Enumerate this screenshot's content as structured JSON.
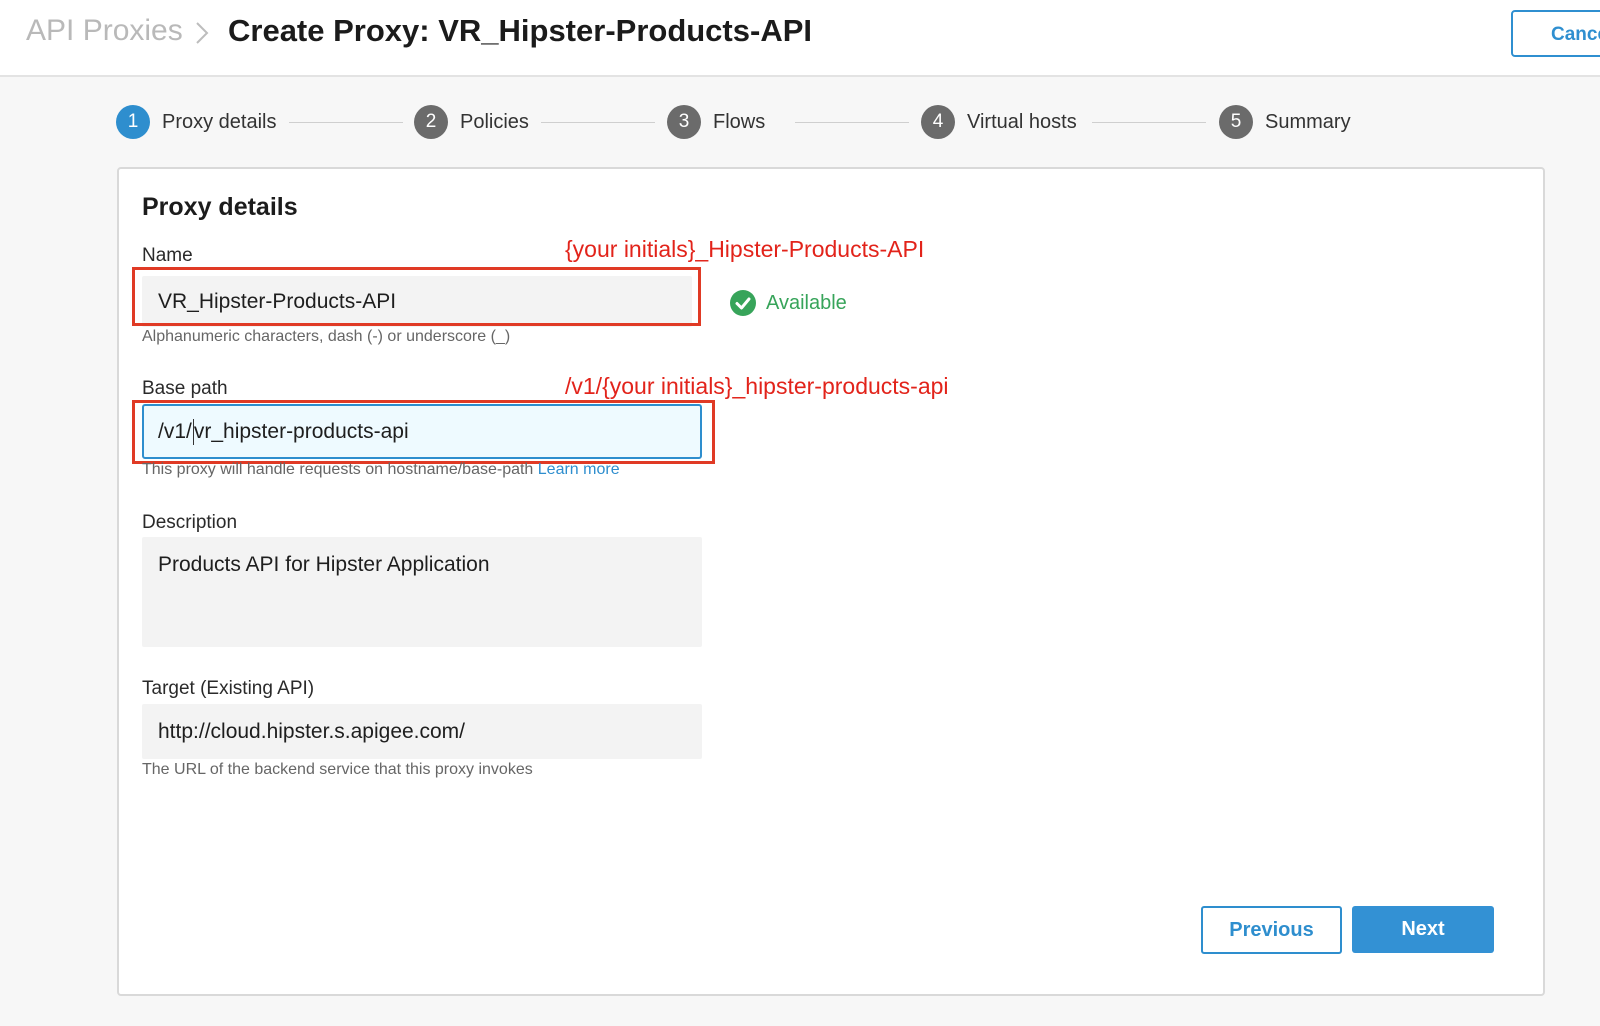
{
  "header": {
    "breadcrumb_root": "API Proxies",
    "title": "Create Proxy: VR_Hipster-Products-API",
    "cancel_label": "Cancel"
  },
  "stepper": {
    "steps": [
      {
        "number": "1",
        "label": "Proxy details",
        "active": true
      },
      {
        "number": "2",
        "label": "Policies",
        "active": false
      },
      {
        "number": "3",
        "label": "Flows",
        "active": false
      },
      {
        "number": "4",
        "label": "Virtual hosts",
        "active": false
      },
      {
        "number": "5",
        "label": "Summary",
        "active": false
      }
    ]
  },
  "form": {
    "section_title": "Proxy details",
    "name": {
      "label": "Name",
      "value": "VR_Hipster-Products-API",
      "status": "Available",
      "hint": "Alphanumeric characters, dash (-) or underscore (_)"
    },
    "base_path": {
      "label": "Base path",
      "value_before_caret": "/v1/",
      "value_after_caret": "vr_hipster-products-api",
      "hint": "This proxy will handle requests on hostname/base-path",
      "hint_link": "Learn more"
    },
    "description": {
      "label": "Description",
      "value": "Products API for Hipster Application"
    },
    "target": {
      "label": "Target (Existing API)",
      "value": "http://cloud.hipster.s.apigee.com/",
      "hint": "The URL of the backend service that this proxy invokes"
    },
    "previous_label": "Previous",
    "next_label": "Next"
  },
  "annotations": {
    "name_note": "{your initials}_Hipster-Products-API",
    "base_path_note": "/v1/{your initials}_hipster-products-api",
    "color": "#e2231a"
  },
  "colors": {
    "accent": "#2e8ece",
    "success": "#37a45a",
    "step_inactive": "#6b6b6b"
  }
}
